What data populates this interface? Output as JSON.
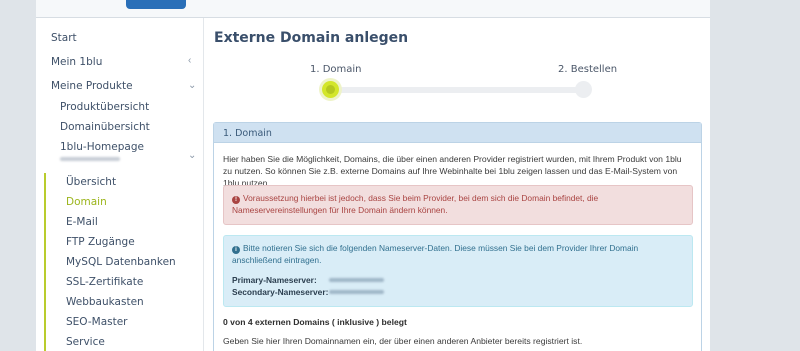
{
  "sidebar": {
    "start": "Start",
    "mein": "Mein 1blu",
    "produkte": "Meine Produkte",
    "sub": [
      "Produktübersicht",
      "Domainübersicht",
      "1blu-Homepage"
    ],
    "sub2": [
      "Übersicht",
      "Domain",
      "E-Mail",
      "FTP Zugänge",
      "MySQL Datenbanken",
      "SSL-Zertifikate",
      "Webbaukasten",
      "SEO-Master",
      "Service"
    ],
    "active": "Domain"
  },
  "main": {
    "title": "Externe Domain anlegen",
    "steps": [
      "1. Domain",
      "2. Bestellen"
    ],
    "panel_title": "1. Domain",
    "intro": "Hier haben Sie die Möglichkeit, Domains, die über einen anderen Provider registriert wurden, mit Ihrem Produkt von 1blu zu nutzen. So können Sie z.B. externe Domains auf Ihre Webinhalte bei 1blu zeigen lassen und das E-Mail-System von 1blu nutzen.",
    "danger": "Voraussetzung hierbei ist jedoch, dass Sie beim Provider, bei dem sich die Domain befindet, die Nameservereinstellungen für Ihre Domain ändern können.",
    "info": "Bitte notieren Sie sich die folgenden Nameserver-Daten. Diese müssen Sie bei dem Provider Ihrer Domain anschließend eintragen.",
    "primary_label": "Primary-Nameserver:",
    "secondary_label": "Secondary-Nameserver:",
    "count": "0 von 4 externen Domains ( inklusive ) belegt",
    "hint": "Geben Sie hier Ihren Domainnamen ein, der über einen anderen Anbieter bereits registriert ist."
  }
}
